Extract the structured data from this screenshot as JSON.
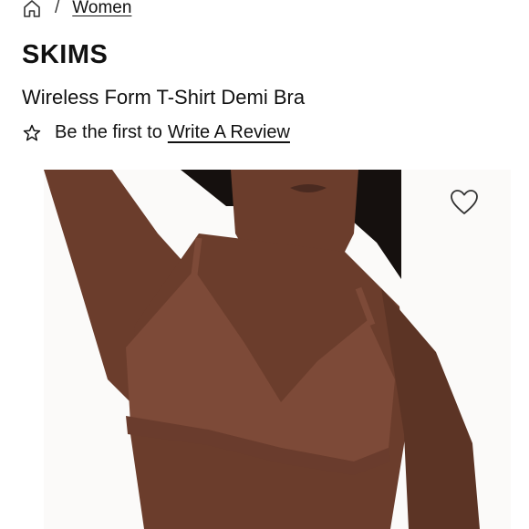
{
  "breadcrumb": {
    "separator": "/",
    "category": "Women"
  },
  "product": {
    "brand": "SKIMS",
    "title": "Wireless Form T-Shirt Demi Bra",
    "review_prompt": "Be the first to",
    "review_link": "Write A Review"
  },
  "icons": {
    "home": "home-icon",
    "star": "star-outline-icon",
    "wishlist": "heart-outline-icon"
  },
  "colors": {
    "text": "#111111",
    "skin": "#6b3d2c",
    "bra": "#7d4a38",
    "hair": "#15100e"
  }
}
